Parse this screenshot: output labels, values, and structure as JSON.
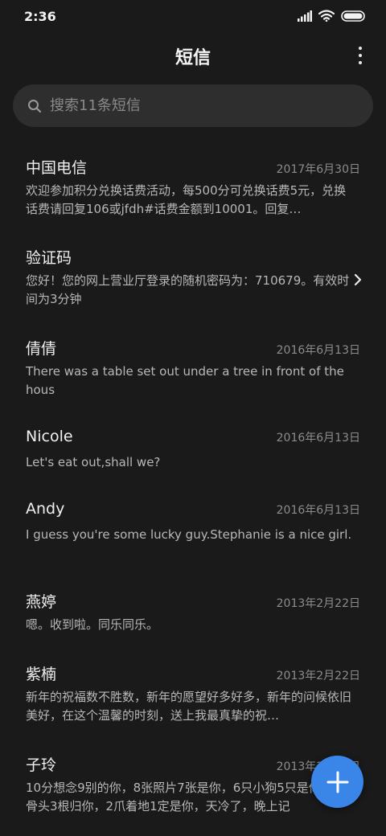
{
  "status": {
    "time": "2:36"
  },
  "header": {
    "title": "短信"
  },
  "search": {
    "placeholder": "搜索11条短信"
  },
  "messages": [
    {
      "sender": "中国电信",
      "date": "2017年6月30日",
      "preview": "欢迎参加积分兑换话费活动，每500分可兑换话费5元，兑换话费请回复106或jfdh#话费金额到10001。回复…"
    },
    {
      "sender": "验证码",
      "date": "",
      "preview": "您好！您的网上营业厅登录的随机密码为：710679。有效时间为3分钟"
    },
    {
      "sender": "倩倩",
      "date": "2016年6月13日",
      "preview": "There was a table set out under a tree in front of the hous"
    },
    {
      "sender": "Nicole",
      "date": "2016年6月13日",
      "preview": "Let's eat out,shall we?"
    },
    {
      "sender": "Andy",
      "date": "2016年6月13日",
      "preview": "I guess you're some lucky guy.Stephanie is a nice girl."
    },
    {
      "sender": "燕婷",
      "date": "2013年2月22日",
      "preview": "嗯。收到啦。同乐同乐。"
    },
    {
      "sender": "紫楠",
      "date": "2013年2月22日",
      "preview": "新年的祝福数不胜数，新年的愿望好多好多，新年的问候依旧美好，在这个温馨的时刻，送上我最真挚的祝…"
    },
    {
      "sender": "子玲",
      "date": "2013年2月22日",
      "preview": "10分想念9别的你，8张照片7张是你，6只小狗5只是你，4根骨头3根归你，2爪着地1定是你，天冷了，晚上记"
    }
  ],
  "colors": {
    "background": "#1a1a1a",
    "search_bg": "#2e2e2e",
    "fab": "#3a86e8"
  },
  "icons": {
    "search": "search-icon",
    "more": "more-vertical-icon",
    "fab": "plus-icon",
    "chevron": "chevron-right-icon"
  }
}
